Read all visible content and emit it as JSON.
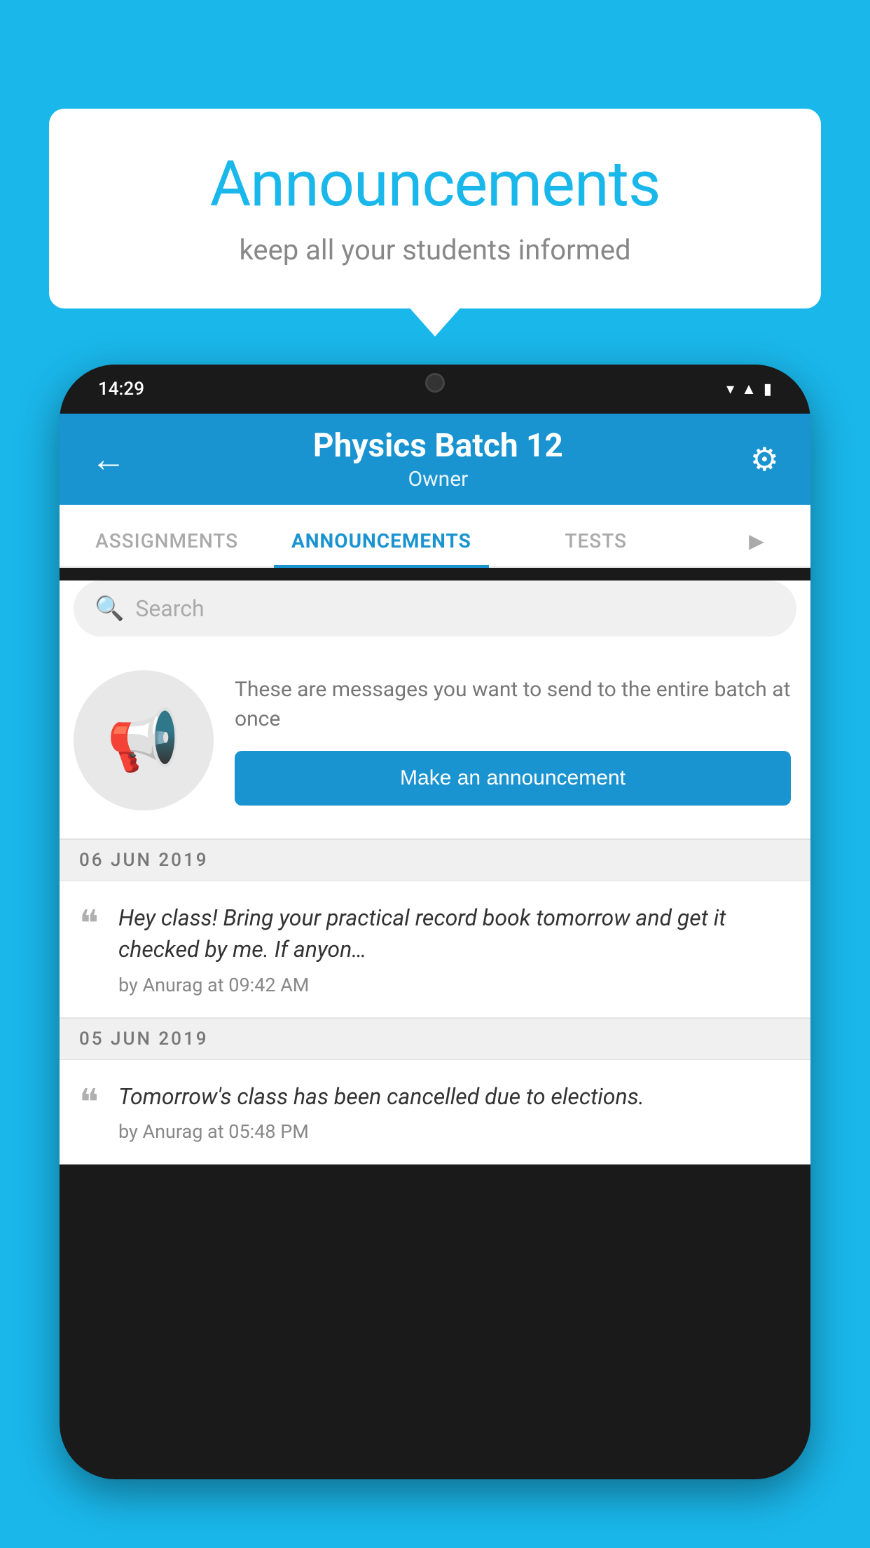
{
  "background_color": "#1ab7ea",
  "bubble": {
    "title": "Announcements",
    "subtitle": "keep all your students informed"
  },
  "phone": {
    "status_bar": {
      "time": "14:29",
      "icons": [
        "wifi",
        "signal",
        "battery"
      ]
    },
    "header": {
      "title": "Physics Batch 12",
      "subtitle": "Owner",
      "back_label": "←",
      "gear_label": "⚙"
    },
    "tabs": [
      {
        "label": "ASSIGNMENTS",
        "active": false
      },
      {
        "label": "ANNOUNCEMENTS",
        "active": true
      },
      {
        "label": "TESTS",
        "active": false
      },
      {
        "label": "",
        "active": false,
        "partial": true
      }
    ],
    "search": {
      "placeholder": "Search"
    },
    "promo": {
      "description": "These are messages you want to send to the entire batch at once",
      "button_label": "Make an announcement"
    },
    "date_separators": [
      {
        "date": "06  JUN  2019"
      },
      {
        "date": "05  JUN  2019"
      }
    ],
    "announcements": [
      {
        "message": "Hey class! Bring your practical record book tomorrow and get it checked by me. If anyon…",
        "meta": "by Anurag at 09:42 AM"
      },
      {
        "message": "Tomorrow's class has been cancelled due to elections.",
        "meta": "by Anurag at 05:48 PM"
      }
    ]
  }
}
